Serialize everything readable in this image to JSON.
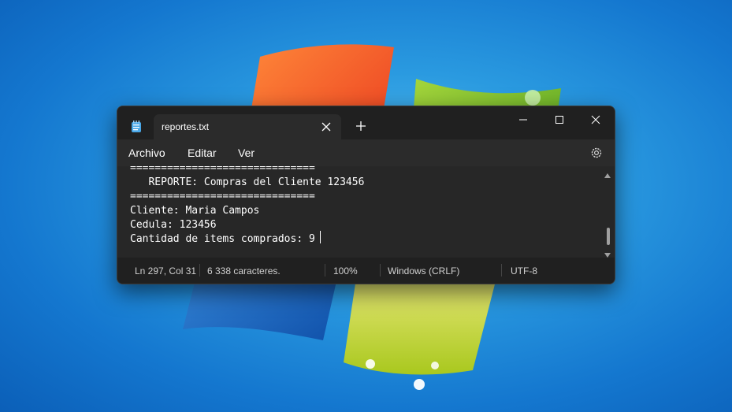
{
  "window": {
    "tab_title": "reportes.txt",
    "icons": {
      "app": "notepad-icon",
      "close_tab": "close-icon",
      "new_tab": "plus-icon",
      "minimize": "minimize-icon",
      "maximize": "maximize-icon",
      "close": "close-icon",
      "settings": "gear-icon"
    }
  },
  "menu": {
    "archivo": "Archivo",
    "editar": "Editar",
    "ver": "Ver"
  },
  "editor": {
    "lines": [
      "==============================",
      "   REPORTE: Compras del Cliente 123456",
      "==============================",
      "Cliente: Maria Campos",
      "Cedula: 123456",
      "Cantidad de items comprados: 9"
    ]
  },
  "status": {
    "position": "Ln 297, Col 31",
    "chars": "6 338 caracteres.",
    "zoom": "100%",
    "line_ending": "Windows (CRLF)",
    "encoding": "UTF-8"
  },
  "colors": {
    "window_bg": "#202020",
    "menu_bg": "#2b2b2b",
    "editor_bg": "#272727",
    "desktop_blue": "#1a86d9"
  }
}
